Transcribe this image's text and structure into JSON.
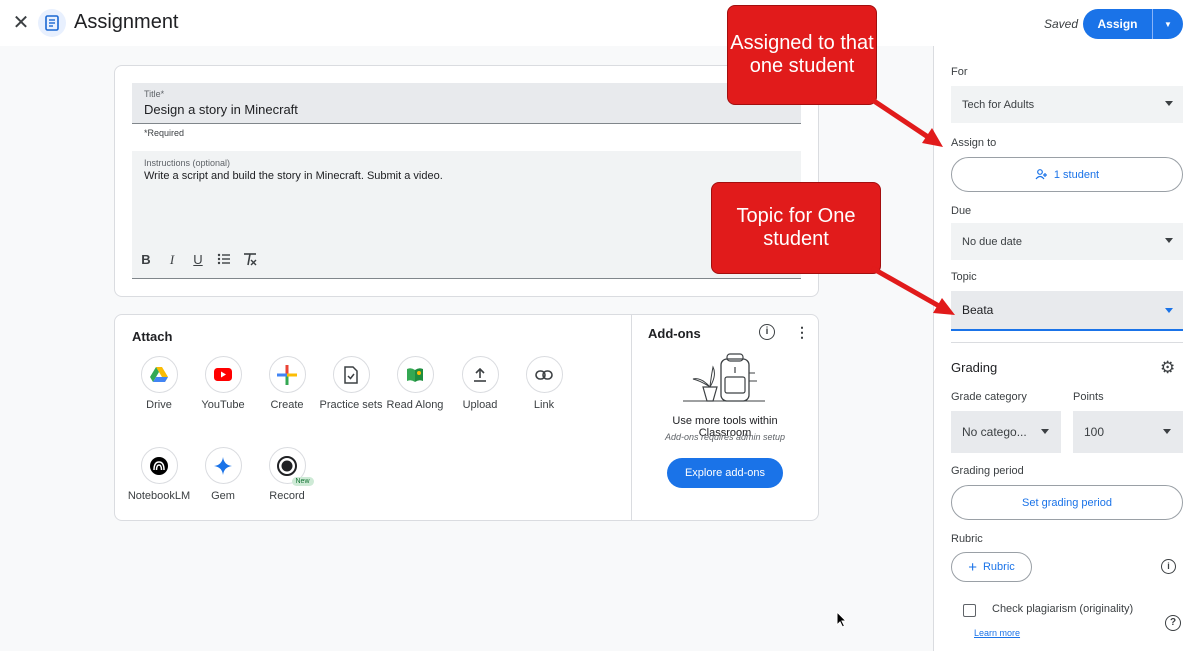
{
  "header": {
    "title": "Assignment",
    "saved": "Saved",
    "assign_label": "Assign"
  },
  "form": {
    "title_label": "Title*",
    "title_value": "Design a story in Minecraft",
    "required_note": "*Required",
    "instructions_label": "Instructions (optional)",
    "instructions_value": "Write a script and build the story in Minecraft. Submit a video."
  },
  "attach": {
    "title": "Attach",
    "items": [
      {
        "label": "Drive"
      },
      {
        "label": "YouTube"
      },
      {
        "label": "Create"
      },
      {
        "label": "Practice sets"
      },
      {
        "label": "Read Along"
      },
      {
        "label": "Upload"
      },
      {
        "label": "Link"
      },
      {
        "label": "NotebookLM"
      },
      {
        "label": "Gem"
      },
      {
        "label": "Record"
      }
    ],
    "new_badge": "New"
  },
  "addons": {
    "title": "Add-ons",
    "text": "Use more tools within Classroom",
    "subtext": "Add-ons requires admin setup",
    "explore_label": "Explore add-ons"
  },
  "sidebar": {
    "for_label": "For",
    "for_value": "Tech for Adults",
    "assign_to_label": "Assign to",
    "assign_to_value": "1 student",
    "due_label": "Due",
    "due_value": "No due date",
    "topic_label": "Topic",
    "topic_value": "Beata",
    "grading_title": "Grading",
    "grade_category_label": "Grade category",
    "grade_category_value": "No catego...",
    "points_label": "Points",
    "points_value": "100",
    "grading_period_label": "Grading period",
    "grading_period_button": "Set grading period",
    "rubric_label": "Rubric",
    "rubric_button": "Rubric",
    "plagiarism_label": "Check plagiarism (originality)",
    "learn_more": "Learn more"
  },
  "callouts": {
    "assigned": "Assigned to that one student",
    "topic": "Topic for One student"
  },
  "colors": {
    "accent": "#1a73e8",
    "callout": "#e11b1b"
  }
}
